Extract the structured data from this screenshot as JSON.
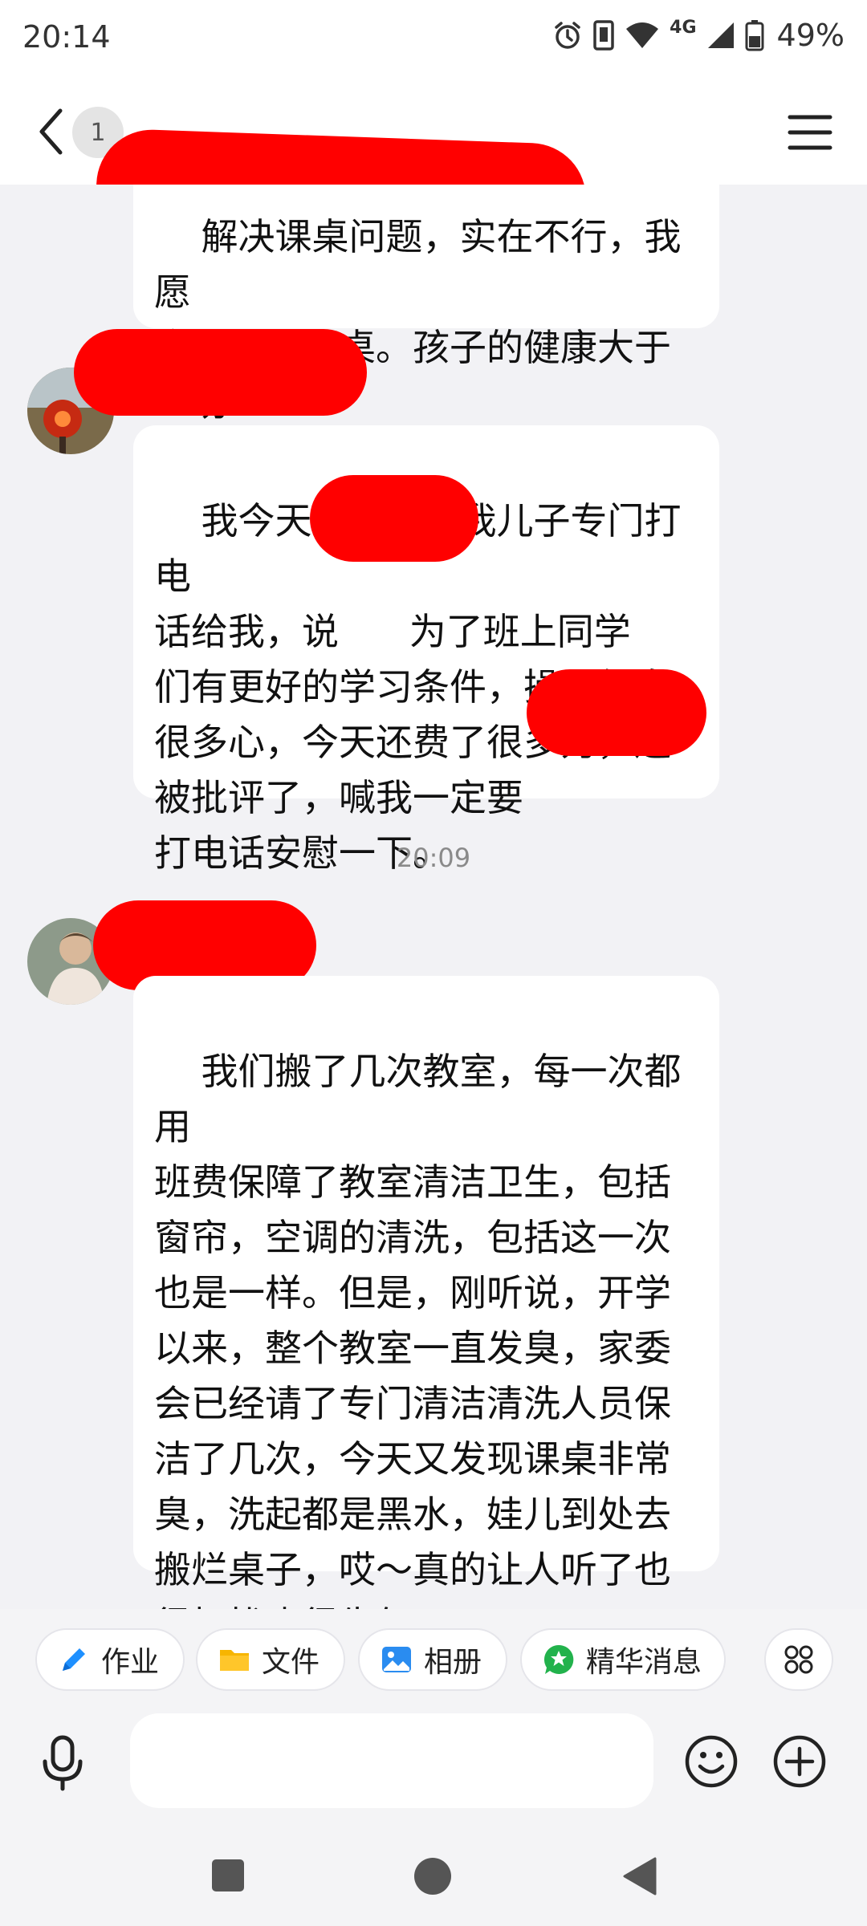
{
  "status_bar": {
    "time": "20:14",
    "network": "4G",
    "battery": "49%",
    "icons": [
      "alarm-icon",
      "vibrate-icon",
      "wifi-icon",
      "cell-signal-icon",
      "battery-icon"
    ]
  },
  "header": {
    "avatar_initial": "1",
    "menu_icon": "hamburger-menu-icon"
  },
  "messages": [
    {
      "text": "解决课桌问题，实在不行，我愿\n意自己买课桌。孩子的健康大于\n一切!!!"
    },
    {
      "text": "我今天不在家，我儿子专门打电\n话给我，说      为了班上同学\n们有更好的学习条件，操了很多\n很多心，今天还费了很多力，还\n被批评了，喊我一定要      \n打电话安慰一下。"
    },
    {
      "text": "我们搬了几次教室，每一次都用\n班费保障了教室清洁卫生，包括\n窗帘，空调的清洗，包括这一次\n也是一样。但是，刚听说，开学\n以来，整个教室一直发臭，家委\n会已经请了专门清洁清洗人员保\n洁了几次，今天又发现课桌非常\n臭，洗起都是黑水，娃儿到处去\n搬烂桌子，哎～真的让人听了也\n很担忧也很生气"
    }
  ],
  "timestamp": "20:09",
  "quick_actions": [
    {
      "label": "作业",
      "icon": "pencil-icon",
      "color": "#1e90ff"
    },
    {
      "label": "文件",
      "icon": "folder-icon",
      "color": "#f7b500"
    },
    {
      "label": "相册",
      "icon": "photo-icon",
      "color": "#2a8cf0"
    },
    {
      "label": "精华消息",
      "icon": "star-badge-icon",
      "color": "#22b24c"
    }
  ],
  "input": {
    "placeholder": ""
  }
}
